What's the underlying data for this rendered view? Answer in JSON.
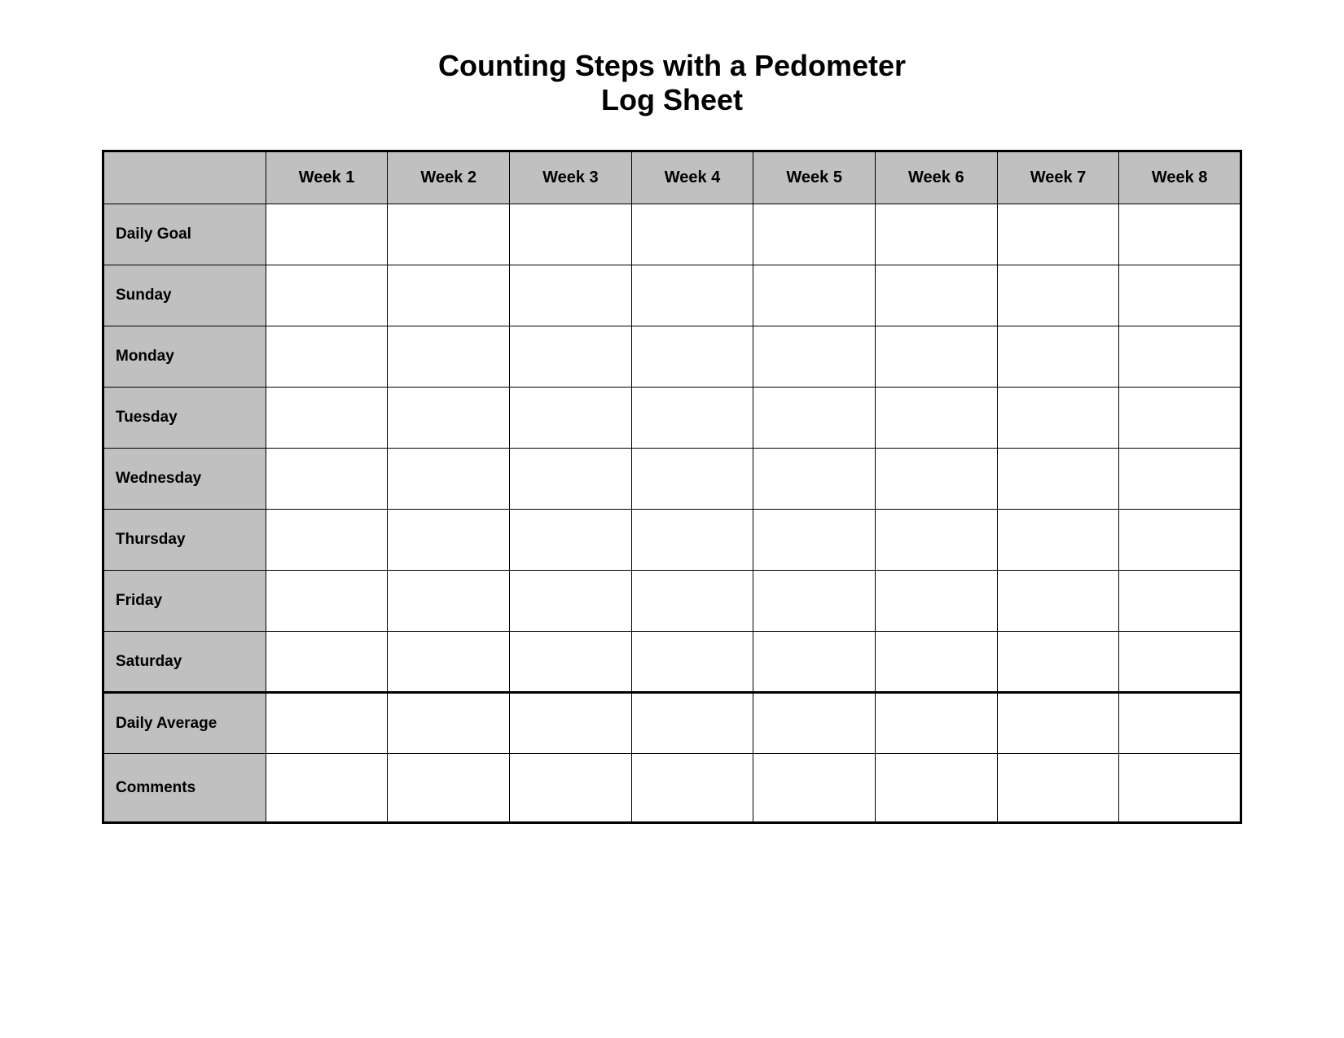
{
  "title": {
    "line1": "Counting Steps with a Pedometer",
    "line2": "Log Sheet"
  },
  "table": {
    "header": {
      "empty": "",
      "weeks": [
        "Week 1",
        "Week 2",
        "Week 3",
        "Week 4",
        "Week 5",
        "Week 6",
        "Week 7",
        "Week 8"
      ]
    },
    "rows": [
      {
        "label": "Daily Goal"
      },
      {
        "label": "Sunday"
      },
      {
        "label": "Monday"
      },
      {
        "label": "Tuesday"
      },
      {
        "label": "Wednesday"
      },
      {
        "label": "Thursday"
      },
      {
        "label": "Friday"
      },
      {
        "label": "Saturday"
      },
      {
        "label": "Daily Average"
      },
      {
        "label": "Comments"
      }
    ]
  }
}
